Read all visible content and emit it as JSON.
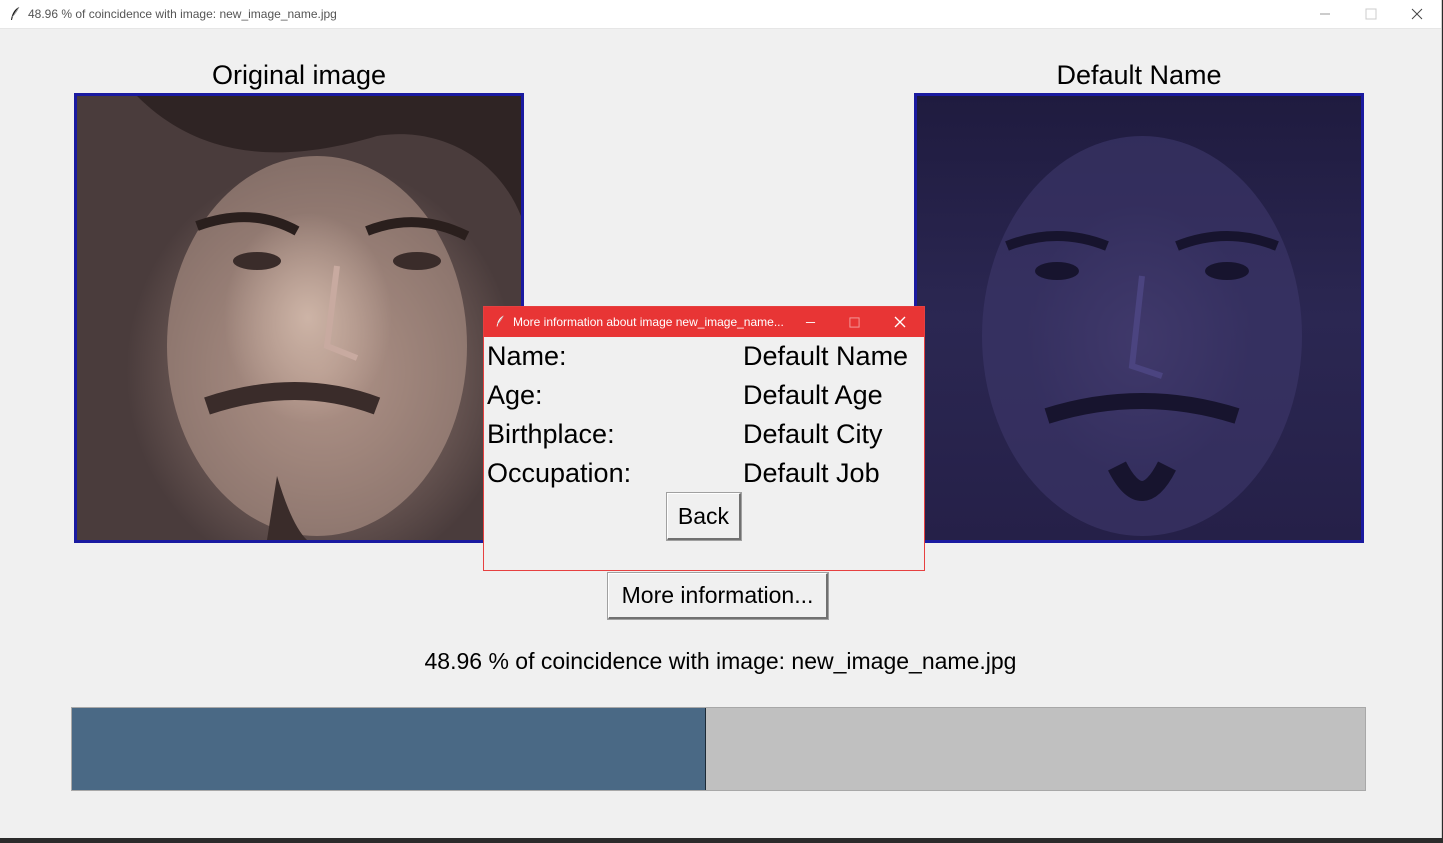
{
  "window": {
    "title": "48.96 % of coincidence with image: new_image_name.jpg"
  },
  "left_panel": {
    "title": "Original image"
  },
  "right_panel": {
    "title": "Default Name"
  },
  "more_info_button": {
    "label": "More information..."
  },
  "coincidence_text": "48.96 % of coincidence with image: new_image_name.jpg",
  "progress": {
    "value_percent": 48.96,
    "fill_color": "#4a6985",
    "track_color": "#c0c0c0"
  },
  "dialog": {
    "title": "More information about image new_image_name...",
    "rows": [
      {
        "label": "Name:",
        "value": "Default Name"
      },
      {
        "label": "Age:",
        "value": "Default Age"
      },
      {
        "label": "Birthplace:",
        "value": "Default City"
      },
      {
        "label": "Occupation:",
        "value": "Default Job"
      }
    ],
    "back_button": {
      "label": "Back"
    },
    "titlebar_color": "#e83535"
  },
  "icons": {
    "app": "feather-icon",
    "minimize": "minimize-icon",
    "maximize": "maximize-icon",
    "close": "close-icon"
  }
}
